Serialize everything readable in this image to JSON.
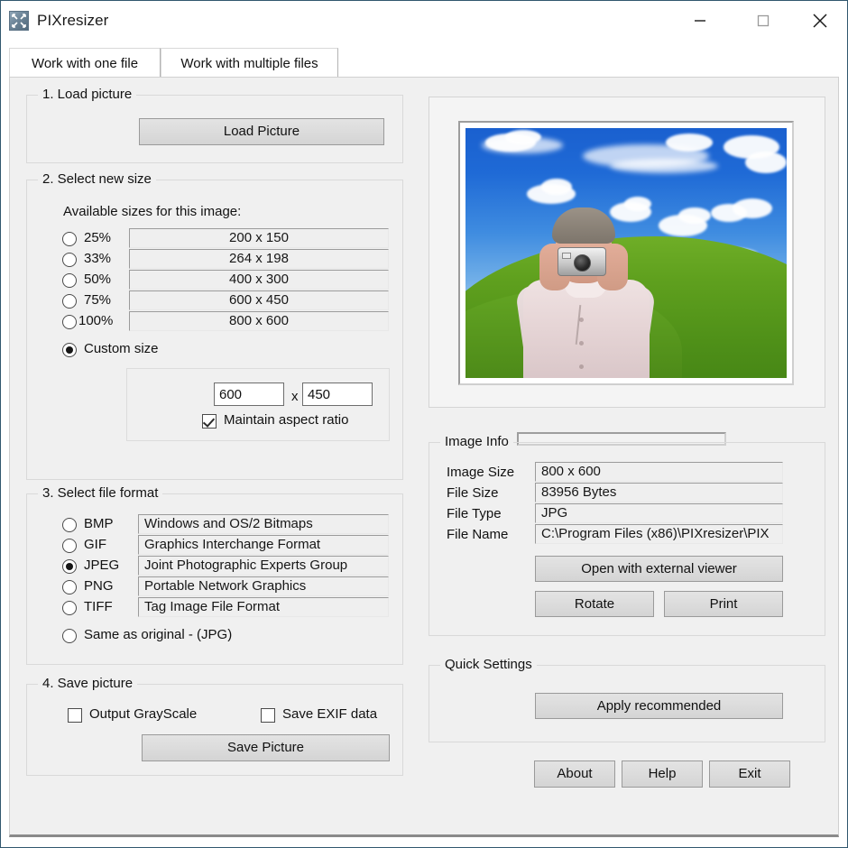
{
  "window": {
    "title": "PIXresizer",
    "icon": "resize-arrows-icon",
    "minimize_label": "—",
    "maximize_label": "□",
    "close_label": "✕",
    "border_color": "#31576e"
  },
  "tabs": [
    {
      "label": "Work with one file",
      "selected": true
    },
    {
      "label": "Work with multiple files",
      "selected": false
    }
  ],
  "load_picture": {
    "group_title": "1. Load picture",
    "button_label": "Load Picture"
  },
  "select_size": {
    "group_title": "2. Select new size",
    "available_label": "Available sizes for this image:",
    "presets": [
      {
        "percent": "25%",
        "size": "200 x 150",
        "selected": false
      },
      {
        "percent": "33%",
        "size": "264 x 198",
        "selected": false
      },
      {
        "percent": "50%",
        "size": "400 x 300",
        "selected": false
      },
      {
        "percent": "75%",
        "size": "600 x 450",
        "selected": false
      },
      {
        "percent": "100%",
        "size": "800 x 600",
        "selected": false
      }
    ],
    "custom_label": "Custom size",
    "custom_selected": true,
    "width_value": "600",
    "times_label": "x",
    "height_value": "450",
    "aspect_label": "Maintain aspect ratio",
    "aspect_checked": true
  },
  "file_format": {
    "group_title": "3. Select file format",
    "formats": [
      {
        "name": "BMP",
        "description": "Windows and OS/2 Bitmaps",
        "selected": false
      },
      {
        "name": "GIF",
        "description": "Graphics Interchange Format",
        "selected": false
      },
      {
        "name": "JPEG",
        "description": "Joint Photographic Experts Group",
        "selected": true
      },
      {
        "name": "PNG",
        "description": "Portable Network Graphics",
        "selected": false
      },
      {
        "name": "TIFF",
        "description": "Tag Image File Format",
        "selected": false
      }
    ],
    "same_as_original_label": "Same as original  - (JPG)",
    "same_as_original_selected": false
  },
  "save_picture": {
    "group_title": "4. Save picture",
    "grayscale_label": "Output GrayScale",
    "grayscale_checked": false,
    "exif_label": "Save EXIF data",
    "exif_checked": false,
    "button_label": "Save Picture"
  },
  "image_info": {
    "group_title": "Image Info",
    "rows": [
      {
        "label": "Image Size",
        "value": "800 x 600"
      },
      {
        "label": "File Size",
        "value": "83956 Bytes"
      },
      {
        "label": "File Type",
        "value": "JPG"
      },
      {
        "label": "File Name",
        "value": "C:\\Program Files (x86)\\PIXresizer\\PIX"
      }
    ],
    "open_external_label": "Open with external viewer",
    "rotate_label": "Rotate",
    "print_label": "Print"
  },
  "quick_settings": {
    "group_title": "Quick Settings",
    "apply_label": "Apply recommended"
  },
  "footer": {
    "about_label": "About",
    "help_label": "Help",
    "exit_label": "Exit"
  }
}
